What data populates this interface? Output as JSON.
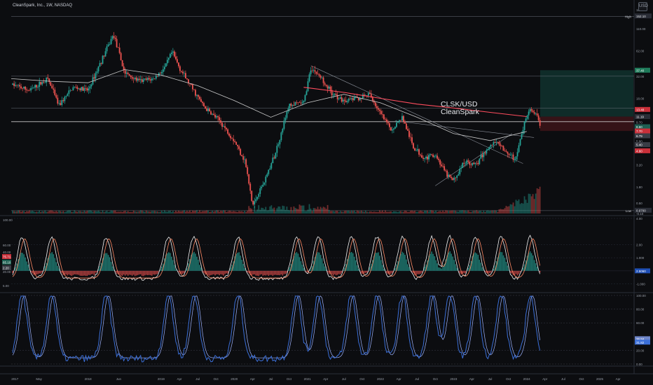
{
  "header": {
    "title": "CleanSpark, Inc., 1W, NASDAQ",
    "currency": "USD"
  },
  "overlay_label": {
    "line1": "CLSK/USD",
    "line2": "CleanSpark"
  },
  "price_axis": {
    "ticks": [
      "180.00",
      "110.00",
      "62.00",
      "32.00",
      "18.00",
      "9.70",
      "5.90",
      "3.20",
      "1.80",
      "1.00",
      "0.50",
      "0.10",
      "-0.10"
    ],
    "high_label": "High",
    "high_value": "152.10",
    "low_label": "Low",
    "low_value": "0.9700",
    "tags": [
      {
        "value": "37.40",
        "color": "#1f7a5a"
      },
      {
        "value": "13.48",
        "color": "#c9303a"
      },
      {
        "value": "11.19",
        "color": "#2a2d36"
      },
      {
        "value": "8.60",
        "color": "#1e5f52"
      },
      {
        "value": "7.70",
        "color": "#c9303a"
      },
      {
        "value": "6.79",
        "color": "#3a3d46"
      },
      {
        "value": "5.40",
        "color": "#3a3d46"
      },
      {
        "value": "4.60",
        "color": "#c9303a"
      }
    ]
  },
  "macd_axis": {
    "ticks": [
      "4.00",
      "2.00",
      "1.000",
      "0.00",
      "-1.000"
    ],
    "left_ticks": [
      "100.00",
      "60.00",
      "40.00",
      "20.00",
      "5.00"
    ],
    "left_tags": [
      "75.71",
      "65.10",
      "2.20"
    ],
    "right_tag": "2.5060"
  },
  "stoch_axis": {
    "ticks": [
      "100.00",
      "80.00",
      "60.00",
      "20.00",
      "0.00"
    ],
    "tags": [
      "36.84",
      "31.82"
    ]
  },
  "time_axis": [
    "2017",
    "May",
    "2018",
    "Jun",
    "2019",
    "Apr",
    "Jul",
    "Oct",
    "2020",
    "Apr",
    "Jul",
    "Oct",
    "2021",
    "Apr",
    "Jul",
    "Oct",
    "2022",
    "Apr",
    "Jul",
    "Oct",
    "2023",
    "Apr",
    "Jul",
    "Oct",
    "2024",
    "Apr",
    "Jul",
    "Oct",
    "2025",
    "Apr"
  ],
  "colors": {
    "background": "#0c0d10",
    "up": "#26a69a",
    "down": "#ef5350",
    "ma_long": "#ff4d5e",
    "ma_short": "#c9c9c9",
    "stoch_k": "#3b6fd8",
    "stoch_d": "#9fb4ff",
    "target_zone": "#10332e",
    "stop_zone": "#3a1418"
  },
  "chart_data": [
    {
      "type": "candlestick",
      "title": "CleanSpark, Inc., 1W, NASDAQ",
      "x_range": [
        "2017",
        "2025"
      ],
      "y_scale": "log",
      "ylim": [
        0.9,
        180
      ],
      "price_path": [
        [
          2016.95,
          26
        ],
        [
          2017.2,
          22
        ],
        [
          2017.45,
          30
        ],
        [
          2017.6,
          15
        ],
        [
          2017.8,
          24
        ],
        [
          2018.0,
          22
        ],
        [
          2018.15,
          42
        ],
        [
          2018.35,
          95
        ],
        [
          2018.5,
          35
        ],
        [
          2018.7,
          28
        ],
        [
          2018.9,
          30
        ],
        [
          2019.05,
          40
        ],
        [
          2019.15,
          60
        ],
        [
          2019.25,
          40
        ],
        [
          2019.4,
          25
        ],
        [
          2019.6,
          14
        ],
        [
          2019.8,
          10
        ],
        [
          2020.0,
          6
        ],
        [
          2020.15,
          3.5
        ],
        [
          2020.25,
          1.1
        ],
        [
          2020.4,
          2
        ],
        [
          2020.55,
          4
        ],
        [
          2020.75,
          15
        ],
        [
          2020.95,
          16
        ],
        [
          2021.05,
          40
        ],
        [
          2021.2,
          30
        ],
        [
          2021.35,
          20
        ],
        [
          2021.5,
          17
        ],
        [
          2021.7,
          18
        ],
        [
          2021.85,
          20
        ],
        [
          2022.0,
          12
        ],
        [
          2022.15,
          8
        ],
        [
          2022.3,
          11
        ],
        [
          2022.45,
          5
        ],
        [
          2022.6,
          3.8
        ],
        [
          2022.75,
          4.2
        ],
        [
          2022.9,
          2.5
        ],
        [
          2023.0,
          2.1
        ],
        [
          2023.15,
          3.5
        ],
        [
          2023.3,
          3.2
        ],
        [
          2023.5,
          5.2
        ],
        [
          2023.6,
          6
        ],
        [
          2023.75,
          4.2
        ],
        [
          2023.85,
          3.7
        ],
        [
          2024.0,
          12
        ],
        [
          2024.05,
          14
        ],
        [
          2024.15,
          11
        ],
        [
          2024.2,
          7
        ]
      ],
      "ma_long": [
        [
          2020.95,
          24
        ],
        [
          2021.5,
          21
        ],
        [
          2022.0,
          18
        ],
        [
          2022.5,
          15.5
        ],
        [
          2023.0,
          14
        ],
        [
          2023.5,
          12.5
        ],
        [
          2024.0,
          11.2
        ]
      ],
      "ma_short": [
        [
          2016.95,
          30
        ],
        [
          2017.5,
          28
        ],
        [
          2018.0,
          27
        ],
        [
          2018.5,
          38
        ],
        [
          2019.0,
          33
        ],
        [
          2019.5,
          25
        ],
        [
          2020.0,
          17
        ],
        [
          2020.5,
          11
        ],
        [
          2021.0,
          16
        ],
        [
          2021.5,
          20
        ],
        [
          2022.0,
          16
        ],
        [
          2022.5,
          11
        ],
        [
          2023.0,
          7.2
        ],
        [
          2023.5,
          6
        ],
        [
          2024.0,
          7.6
        ]
      ],
      "horizontal_levels": [
        152.1,
        32,
        14,
        9.8,
        0.97
      ],
      "projection": {
        "entry": 11.2,
        "target": 37.4,
        "stop": 7.7
      },
      "annotation": "CLSK/USD CleanSpark"
    },
    {
      "type": "bar",
      "title": "",
      "series": [
        {
          "name": "",
          "values": "macd-histogram"
        }
      ],
      "ylim": [
        -1.5,
        4
      ]
    },
    {
      "type": "line",
      "title": "",
      "series": [
        {
          "name": "",
          "values": "stochastic"
        }
      ],
      "ylim": [
        0,
        100
      ]
    }
  ]
}
